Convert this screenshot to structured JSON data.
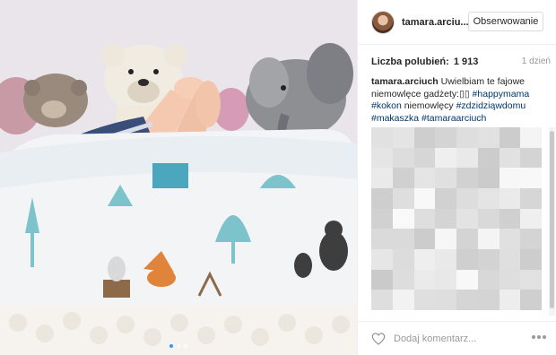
{
  "post": {
    "username": "tamara.arciuch",
    "username_truncated": "tamara.arciu...",
    "follow_label": "Obserwowanie",
    "likes_label": "Liczba polubień:",
    "likes_count": "1 913",
    "time_ago": "1 dzień",
    "caption": {
      "user": "tamara.arciuch",
      "text_1": "Uwielbiam te fajowe niemowlęce gadżety:",
      "emoji": "▯▯",
      "tag_1": "#happymama",
      "tag_2": "#kokon",
      "text_2": "niemowlęcy",
      "tag_3": "#zdzidziąwdomu",
      "tag_4": "#makaszka",
      "tag_5": "#tamaraarciuch"
    }
  },
  "comment_box": {
    "placeholder": "Dodaj komentarz..."
  },
  "carousel": {
    "slide_count": 3,
    "active_index": 0
  },
  "colors": {
    "accent": "#3897f0",
    "hashtag": "#003569",
    "muted": "#999999"
  },
  "icons": {
    "like": "heart-icon",
    "more": "more-options-icon"
  }
}
